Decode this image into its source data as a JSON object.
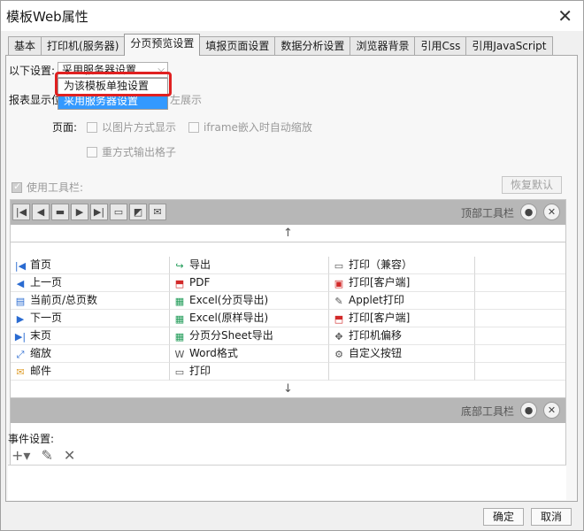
{
  "window": {
    "title": "模板Web属性",
    "close_glyph": "✕"
  },
  "tabs": [
    {
      "label": "基本"
    },
    {
      "label": "打印机(服务器)"
    },
    {
      "label": "分页预览设置"
    },
    {
      "label": "填报页面设置"
    },
    {
      "label": "数据分析设置"
    },
    {
      "label": "浏览器背景"
    },
    {
      "label": "引用Css"
    },
    {
      "label": "引用JavaScript"
    }
  ],
  "settings": {
    "label": "以下设置:",
    "combo_value": "采用服务器设置",
    "dropdown": [
      "为该模板单独设置",
      "采用服务器设置"
    ],
    "report_display_label": "报表显示位",
    "report_display_value": "左展示",
    "page_label": "页面:",
    "option_image": "以图片方式显示",
    "option_iframe": "iframe嵌入时自动缩放",
    "option_grid": "重方式输出格子"
  },
  "toolbar": {
    "use_label": "使用工具栏:",
    "restore_label": "恢复默认",
    "top_label": "顶部工具栏",
    "bottom_label": "底部工具栏",
    "up_arrow": "↑",
    "down_arrow": "↓",
    "items": [
      [
        "首页",
        "导出",
        "打印（兼容）",
        ""
      ],
      [
        "上一页",
        "PDF",
        "打印[客户端]",
        ""
      ],
      [
        "当前页/总页数",
        "Excel(分页导出)",
        "Applet打印",
        ""
      ],
      [
        "下一页",
        "Excel(原样导出)",
        "打印[客户端]",
        ""
      ],
      [
        "末页",
        "分页分Sheet导出",
        "打印机偏移",
        ""
      ],
      [
        "缩放",
        "Word格式",
        "自定义按钮",
        ""
      ],
      [
        "邮件",
        "打印",
        "",
        ""
      ]
    ]
  },
  "events": {
    "label": "事件设置:"
  },
  "footer": {
    "ok": "确定",
    "cancel": "取消"
  }
}
